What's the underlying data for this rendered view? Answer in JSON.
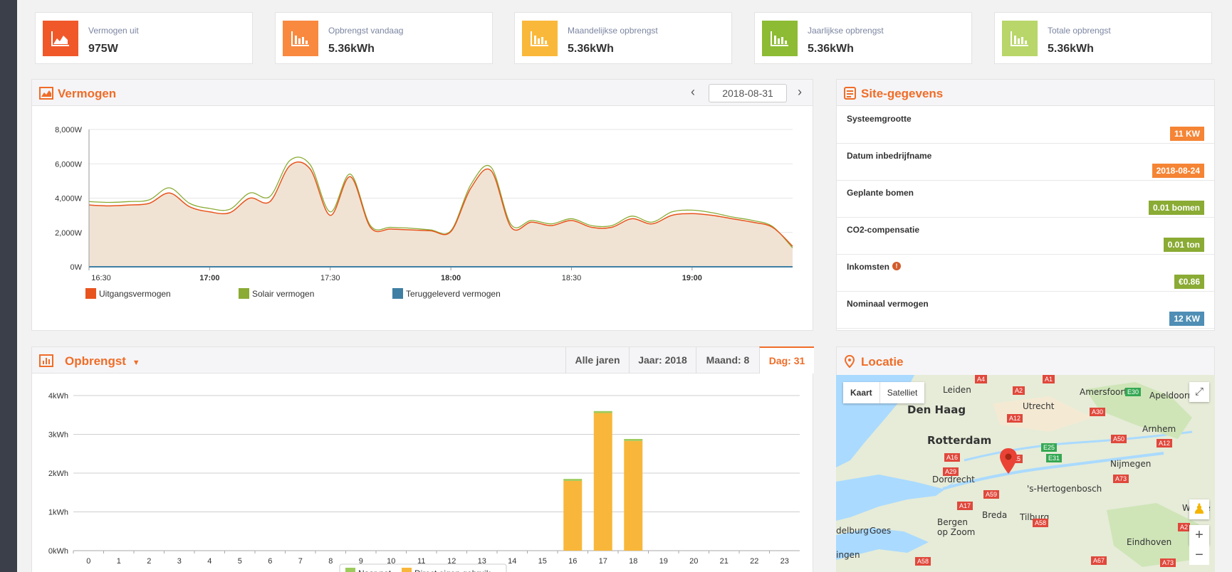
{
  "stats": [
    {
      "label": "Vermogen uit",
      "value": "975W",
      "color": "#f0582a",
      "icon": "area-chart-icon"
    },
    {
      "label": "Opbrengst vandaag",
      "value": "5.36kWh",
      "color": "#f8893f",
      "icon": "bar-chart-icon"
    },
    {
      "label": "Maandelijkse opbrengst",
      "value": "5.36kWh",
      "color": "#fab83a",
      "icon": "bar-chart-icon"
    },
    {
      "label": "Jaarlijkse opbrengst",
      "value": "5.36kWh",
      "color": "#8dbb33",
      "icon": "bar-chart-icon"
    },
    {
      "label": "Totale opbrengst",
      "value": "5.36kWh",
      "color": "#b8d66a",
      "icon": "bar-chart-icon"
    }
  ],
  "power_panel": {
    "title": "Vermogen",
    "date": "2018-08-31"
  },
  "site_panel": {
    "title": "Site-gegevens",
    "rows": [
      {
        "label": "Systeemgrootte",
        "value": "11 KW",
        "color": "#f58434"
      },
      {
        "label": "Datum inbedrijfname",
        "value": "2018-08-24",
        "color": "#f58434"
      },
      {
        "label": "Geplante bomen",
        "value": "0.01 bomen",
        "color": "#8aab34"
      },
      {
        "label": "CO2-compensatie",
        "value": "0.01 ton",
        "color": "#8aab34"
      },
      {
        "label": "Inkomsten",
        "value": "€0.86",
        "color": "#8aab34"
      },
      {
        "label": "Nominaal vermogen",
        "value": "12 KW",
        "color": "#4f8eb5"
      }
    ]
  },
  "yield_panel": {
    "title": "Opbrengst",
    "tabs": [
      "Alle jaren",
      "Jaar: 2018",
      "Maand: 8",
      "Dag: 31"
    ],
    "active_tab": 3
  },
  "location_panel": {
    "title": "Locatie",
    "map_tabs": [
      "Kaart",
      "Satelliet"
    ],
    "places": [
      "Leiden",
      "Den Haag",
      "Utrecht",
      "Amersfoort",
      "Apeldoorn",
      "Rotterdam",
      "Arnhem",
      "Dordrecht",
      "Nijmegen",
      "'s-Hertogenbosch",
      "Breda",
      "Tilburg",
      "Bergen op Zoom",
      "Eindhoven",
      "Weeze",
      "delburg",
      "Goes",
      "ingen"
    ],
    "roads": [
      "A4",
      "A2",
      "A1",
      "E30",
      "A12",
      "A30",
      "A16",
      "A15",
      "A29",
      "E25",
      "E31",
      "A50",
      "A12",
      "A59",
      "A73",
      "A17",
      "A58",
      "A67",
      "A58",
      "A73",
      "A2"
    ]
  },
  "chart_data": [
    {
      "type": "area",
      "title": "",
      "ylabel": "",
      "ylim": [
        0,
        8000
      ],
      "y_ticks": [
        "0W",
        "2,000W",
        "4,000W",
        "6,000W",
        "8,000W"
      ],
      "x_ticks": [
        "16:30",
        "17:00",
        "17:30",
        "18:00",
        "18:30",
        "19:00"
      ],
      "x_ticks_bold": [
        false,
        true,
        false,
        true,
        false,
        true
      ],
      "x_range": [
        "16:30",
        "19:25"
      ],
      "x": [
        "16:30",
        "16:35",
        "16:40",
        "16:45",
        "16:50",
        "16:55",
        "17:00",
        "17:05",
        "17:10",
        "17:15",
        "17:20",
        "17:25",
        "17:30",
        "17:35",
        "17:40",
        "17:45",
        "17:50",
        "17:55",
        "18:00",
        "18:05",
        "18:10",
        "18:15",
        "18:20",
        "18:25",
        "18:30",
        "18:35",
        "18:40",
        "18:45",
        "18:50",
        "18:55",
        "19:00",
        "19:05",
        "19:10",
        "19:15",
        "19:20",
        "19:25"
      ],
      "series": [
        {
          "name": "Uitgangsvermogen",
          "color": "#e8541e",
          "values": [
            3600,
            3550,
            3600,
            3700,
            4300,
            3500,
            3200,
            3150,
            4000,
            3800,
            5900,
            5700,
            3000,
            5250,
            2300,
            2200,
            2150,
            2100,
            2050,
            4600,
            5600,
            2300,
            2600,
            2400,
            2700,
            2300,
            2300,
            2800,
            2500,
            3000,
            3100,
            3000,
            2800,
            2600,
            2300,
            1200
          ]
        },
        {
          "name": "Solair vermogen",
          "color": "#8aab34",
          "values": [
            3800,
            3750,
            3800,
            3900,
            4600,
            3700,
            3400,
            3350,
            4300,
            4100,
            6200,
            5950,
            3200,
            5400,
            2400,
            2300,
            2250,
            2150,
            2100,
            4800,
            5800,
            2450,
            2700,
            2500,
            2800,
            2400,
            2400,
            2950,
            2600,
            3200,
            3300,
            3150,
            2900,
            2700,
            2350,
            1100
          ]
        },
        {
          "name": "Teruggeleverd vermogen",
          "color": "#3f7fa3",
          "values": [
            0,
            0,
            0,
            0,
            0,
            0,
            0,
            0,
            0,
            0,
            0,
            0,
            0,
            0,
            0,
            0,
            0,
            0,
            0,
            0,
            0,
            0,
            0,
            0,
            0,
            0,
            0,
            0,
            0,
            0,
            0,
            0,
            0,
            0,
            0,
            0
          ]
        }
      ],
      "legend": "bottom-left"
    },
    {
      "type": "bar",
      "title": "",
      "ylim": [
        0,
        4
      ],
      "y_ticks": [
        "0kWh",
        "1kWh",
        "2kWh",
        "3kWh",
        "4kWh"
      ],
      "categories": [
        "0",
        "1",
        "2",
        "3",
        "4",
        "5",
        "6",
        "7",
        "8",
        "9",
        "10",
        "11",
        "12",
        "13",
        "14",
        "15",
        "16",
        "17",
        "18",
        "19",
        "20",
        "21",
        "22",
        "23"
      ],
      "stacked": true,
      "series": [
        {
          "name": "Direct eigen gebruik",
          "color": "#f8b73a",
          "values": [
            0,
            0,
            0,
            0,
            0,
            0,
            0,
            0,
            0,
            0,
            0,
            0,
            0,
            0,
            0,
            0,
            1.8,
            3.55,
            2.83,
            0,
            0,
            0,
            0,
            0
          ]
        },
        {
          "name": "Naar net",
          "color": "#9ccb5b",
          "values": [
            0,
            0,
            0,
            0,
            0,
            0,
            0,
            0,
            0,
            0,
            0,
            0,
            0,
            0,
            0,
            0,
            0.05,
            0.05,
            0.05,
            0,
            0,
            0,
            0,
            0
          ]
        }
      ],
      "legend": [
        "Naar net",
        "Direct eigen gebruik"
      ]
    }
  ]
}
